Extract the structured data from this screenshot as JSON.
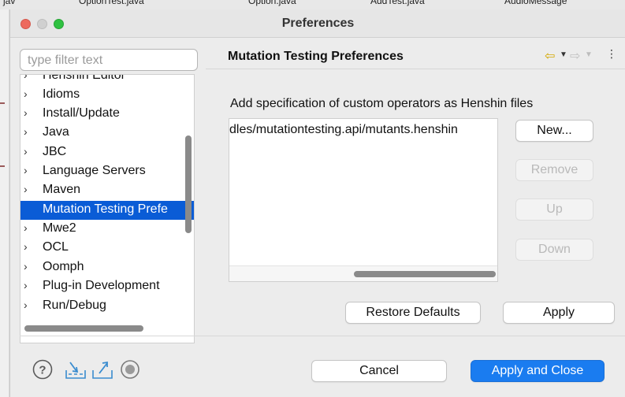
{
  "background": {
    "tabs": [
      "jav",
      "OptionTest.java",
      "Option.java",
      "AddTest.java",
      "AudioMessage"
    ]
  },
  "window": {
    "title": "Preferences"
  },
  "left": {
    "filter_placeholder": "type filter text",
    "tree_items": [
      {
        "label": "Henshin Editor",
        "expanded": false,
        "selected": false
      },
      {
        "label": "Idioms",
        "expanded": false,
        "selected": false
      },
      {
        "label": "Install/Update",
        "expanded": false,
        "selected": false
      },
      {
        "label": "Java",
        "expanded": false,
        "selected": false
      },
      {
        "label": "JBC",
        "expanded": false,
        "selected": false
      },
      {
        "label": "Language Servers",
        "expanded": false,
        "selected": false
      },
      {
        "label": "Maven",
        "expanded": false,
        "selected": false
      },
      {
        "label": "Mutation Testing Prefe",
        "expanded": false,
        "selected": true,
        "leaf": true
      },
      {
        "label": "Mwe2",
        "expanded": false,
        "selected": false
      },
      {
        "label": "OCL",
        "expanded": false,
        "selected": false
      },
      {
        "label": "Oomph",
        "expanded": false,
        "selected": false
      },
      {
        "label": "Plug-in Development",
        "expanded": false,
        "selected": false
      },
      {
        "label": "Run/Debug",
        "expanded": false,
        "selected": false
      }
    ]
  },
  "page": {
    "title": "Mutation Testing Preferences",
    "description": "Add specification of custom operators as Henshin files",
    "files": [
      "dles/mutationtesting.api/mutants.henshin"
    ],
    "buttons": {
      "new": "New...",
      "remove": "Remove",
      "up": "Up",
      "down": "Down",
      "restore_defaults": "Restore Defaults",
      "apply": "Apply"
    }
  },
  "footer": {
    "cancel": "Cancel",
    "apply_close": "Apply and Close"
  },
  "colors": {
    "selection": "#0a5cd6",
    "primary_button": "#1a7cf0",
    "back_arrow": "#d4a800"
  }
}
